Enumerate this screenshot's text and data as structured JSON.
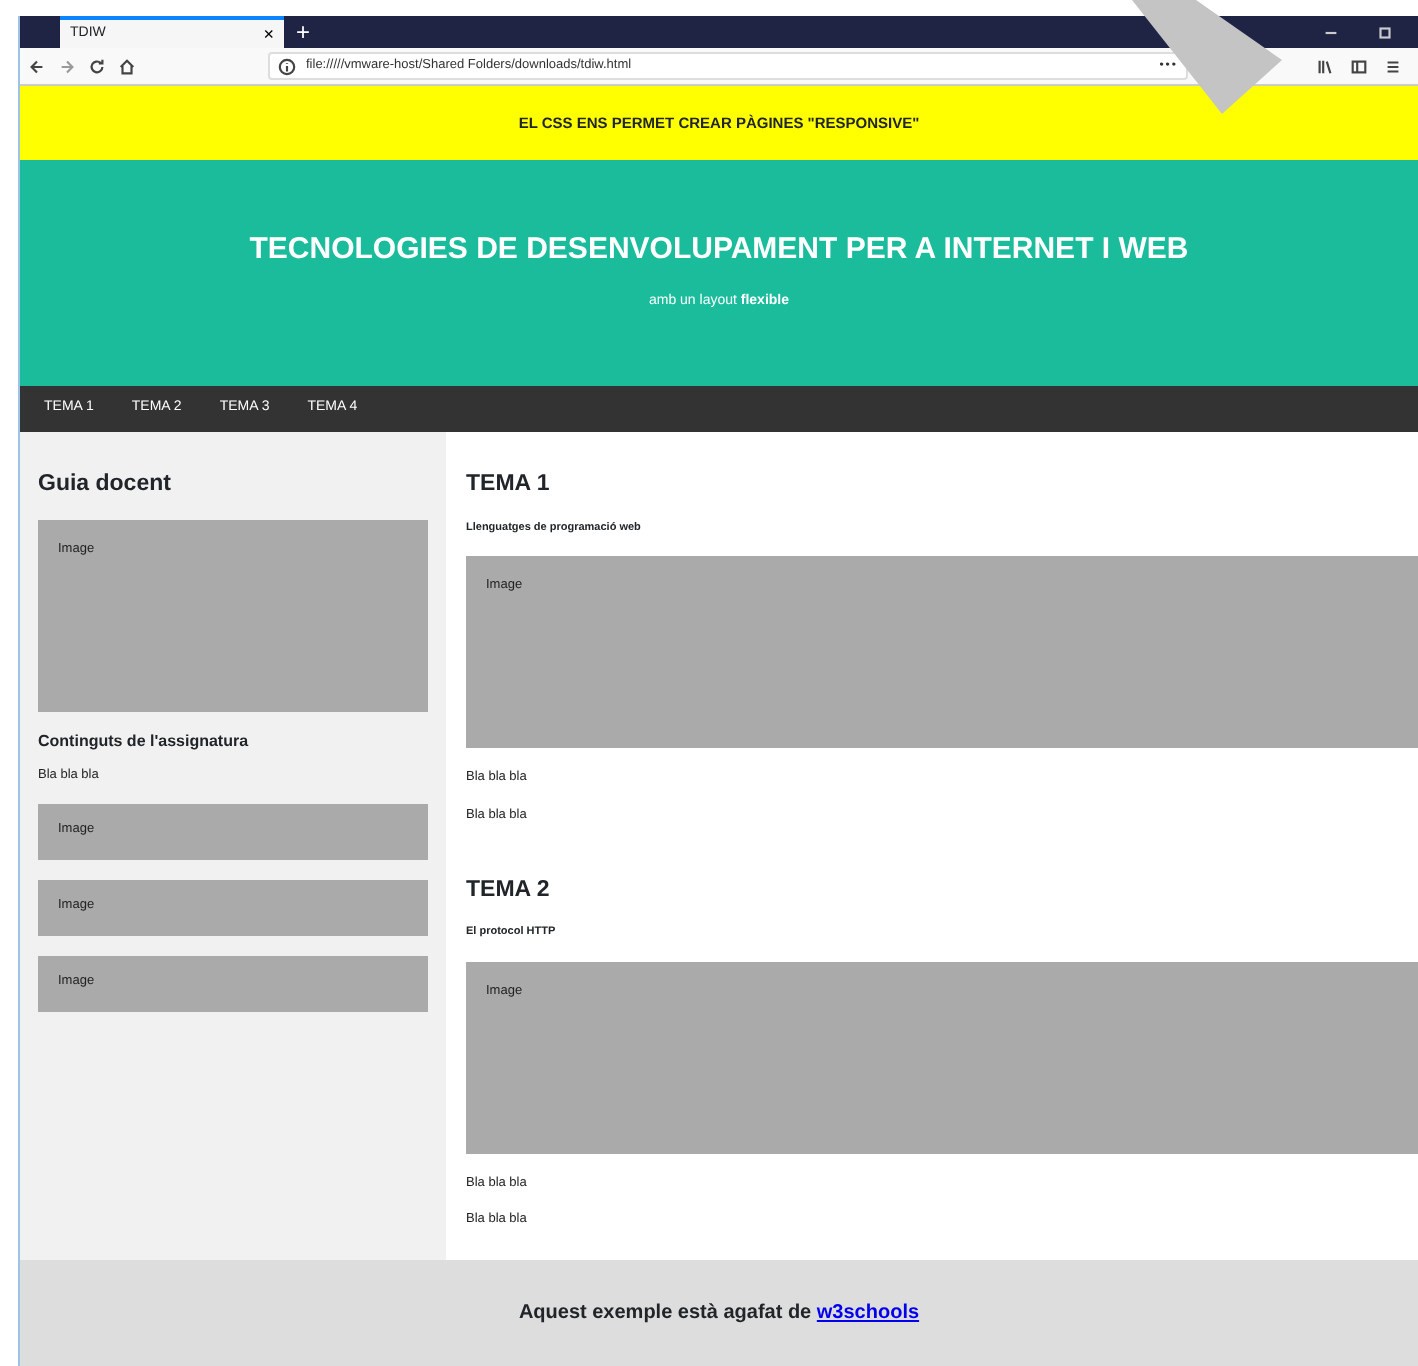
{
  "browser": {
    "tab_title": "TDIW",
    "tab_close": "×",
    "new_tab": "+",
    "url": "file://///vmware-host/Shared Folders/downloads/tdiw.html",
    "page_actions": "•••"
  },
  "banner": "EL CSS ENS PERMET CREAR PÀGINES \"RESPONSIVE\"",
  "header": {
    "title": "TECNOLOGIES DE DESENVOLUPAMENT PER A INTERNET I WEB",
    "subtitle": "amb un layout **flexible**"
  },
  "nav": [
    "TEMA 1",
    "TEMA 2",
    "TEMA 3",
    "TEMA 4"
  ],
  "sidebar": {
    "title": "Guia docent",
    "image": "Image",
    "subtitle": "Continguts de l'assignatura",
    "text": "Bla bla bla",
    "images": [
      "Image",
      "Image",
      "Image"
    ]
  },
  "sections": [
    {
      "title": "TEMA 1",
      "subtitle": "Llenguatges de programació web",
      "image": "Image",
      "paragraphs": [
        "Bla bla bla",
        "Bla bla bla"
      ]
    },
    {
      "title": "TEMA 2",
      "subtitle": "El protocol HTTP",
      "image": "Image",
      "paragraphs": [
        "Bla bla bla",
        "Bla bla bla"
      ]
    }
  ],
  "footer": {
    "text": "Aquest exemple està agafat de ",
    "link": "w3schools"
  }
}
